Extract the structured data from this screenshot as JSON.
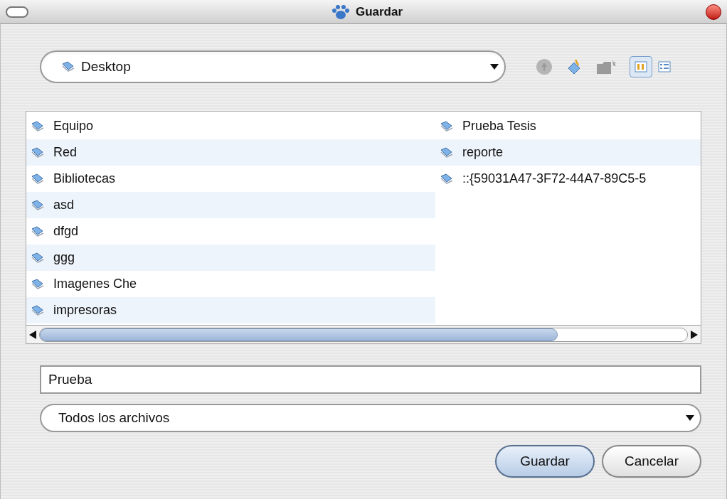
{
  "window": {
    "title": "Guardar"
  },
  "location": {
    "value": "Desktop"
  },
  "view_buttons": [
    {
      "kind": "list",
      "selected": true
    },
    {
      "kind": "details",
      "selected": false
    }
  ],
  "file_list": {
    "columns": [
      [
        "Equipo",
        "Red",
        "Bibliotecas",
        "asd",
        "dfgd",
        "ggg",
        "Imagenes Che",
        "impresoras"
      ],
      [
        "Prueba Tesis",
        "reporte",
        "::{59031A47-3F72-44A7-89C5-5"
      ]
    ]
  },
  "file_name": {
    "value": "Prueba"
  },
  "file_type": {
    "value": "Todos los archivos"
  },
  "buttons": [
    {
      "label": "Guardar",
      "default": true
    },
    {
      "label": "Cancelar",
      "default": false
    }
  ]
}
